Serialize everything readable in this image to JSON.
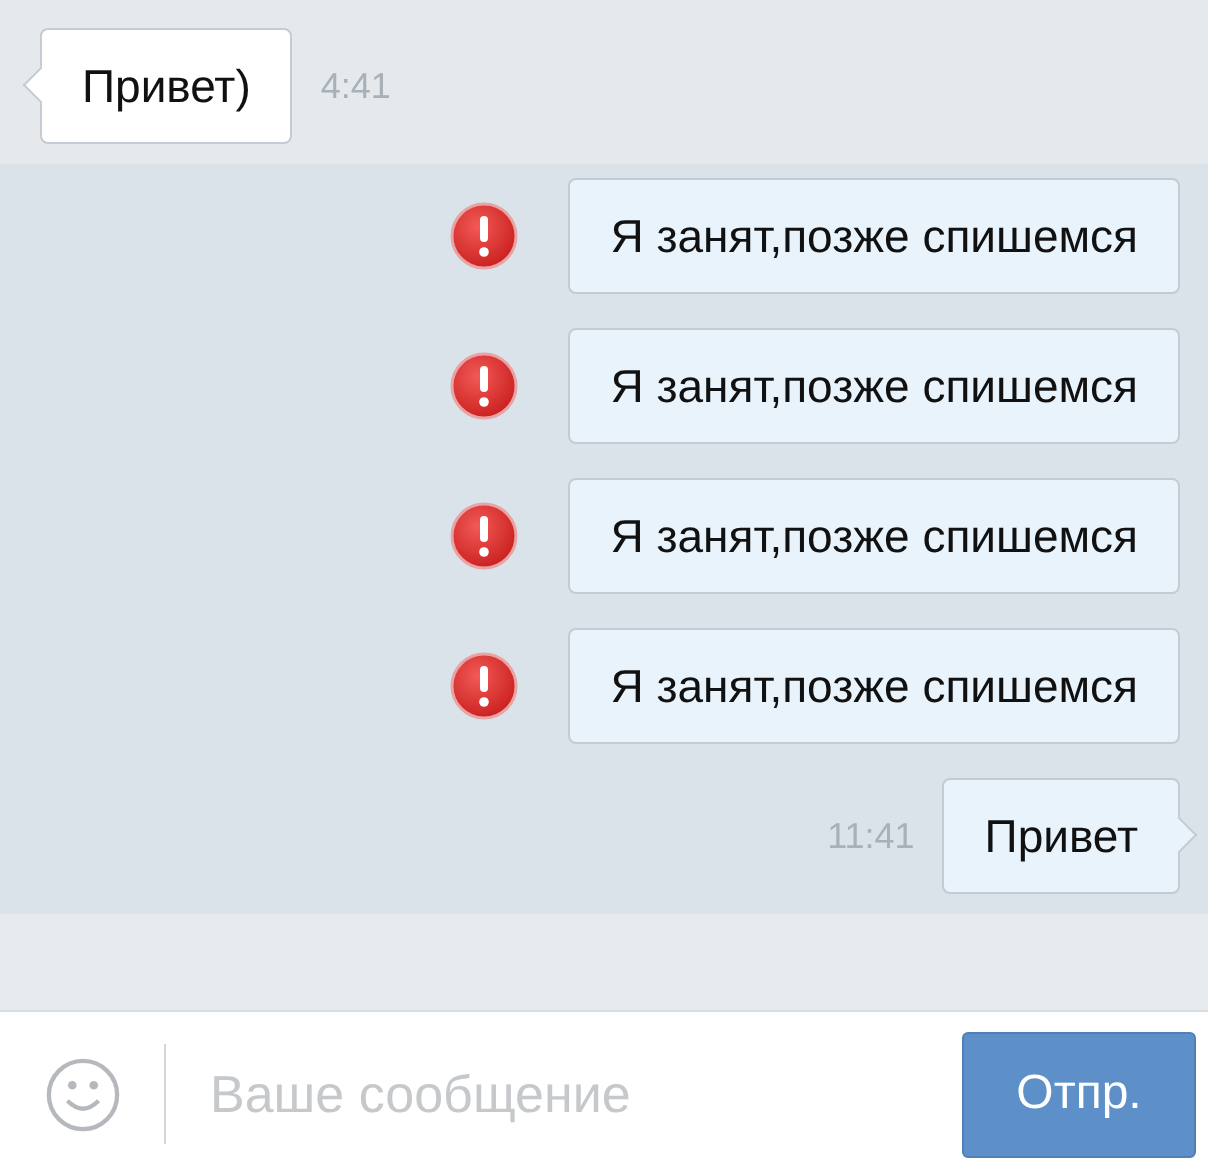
{
  "messages": [
    {
      "kind": "incoming",
      "text": "Привет)",
      "time": "4:41",
      "failed": false,
      "tail": true
    },
    {
      "kind": "outgoing",
      "text": "Я занят,позже спишемся",
      "failed": true,
      "tail": false
    },
    {
      "kind": "outgoing",
      "text": "Я занят,позже спишемся",
      "failed": true,
      "tail": false
    },
    {
      "kind": "outgoing",
      "text": "Я занят,позже спишемся",
      "failed": true,
      "tail": false
    },
    {
      "kind": "outgoing",
      "text": "Я занят,позже спишемся",
      "failed": true,
      "tail": false
    },
    {
      "kind": "outgoing",
      "text": "Привет",
      "time": "11:41",
      "failed": false,
      "tail": true
    }
  ],
  "composer": {
    "placeholder": "Ваше сообщение",
    "send_button": "Отпр."
  }
}
